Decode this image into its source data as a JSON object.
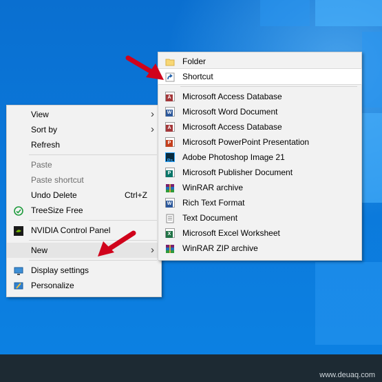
{
  "context_menu": {
    "items": [
      {
        "label": "View"
      },
      {
        "label": "Sort by"
      },
      {
        "label": "Refresh"
      },
      {
        "label": "Paste"
      },
      {
        "label": "Paste shortcut"
      },
      {
        "label": "Undo Delete",
        "shortcut": "Ctrl+Z"
      },
      {
        "label": "TreeSize Free"
      },
      {
        "label": "NVIDIA Control Panel"
      },
      {
        "label": "New"
      },
      {
        "label": "Display settings"
      },
      {
        "label": "Personalize"
      }
    ]
  },
  "new_submenu": {
    "items": [
      {
        "label": "Folder",
        "icon": "folder-icon"
      },
      {
        "label": "Shortcut",
        "icon": "shortcut-icon"
      },
      {
        "label": "Microsoft Access Database",
        "icon": "access-icon",
        "badge": "A",
        "color": "#a4373a"
      },
      {
        "label": "Microsoft Word Document",
        "icon": "word-icon",
        "badge": "W",
        "color": "#2b579a"
      },
      {
        "label": "Microsoft Access Database",
        "icon": "access-icon",
        "badge": "A",
        "color": "#a4373a"
      },
      {
        "label": "Microsoft PowerPoint Presentation",
        "icon": "powerpoint-icon",
        "badge": "P",
        "color": "#c43e1c"
      },
      {
        "label": "Adobe Photoshop Image 21",
        "icon": "photoshop-icon",
        "badge": "Ps",
        "color": "#0a2b3d"
      },
      {
        "label": "Microsoft Publisher Document",
        "icon": "publisher-icon",
        "badge": "P",
        "color": "#077568"
      },
      {
        "label": "WinRAR archive",
        "icon": "winrar-icon"
      },
      {
        "label": "Rich Text Format",
        "icon": "rtf-icon",
        "badge": "W",
        "color": "#2b579a"
      },
      {
        "label": "Text Document",
        "icon": "text-document-icon"
      },
      {
        "label": "Microsoft Excel Worksheet",
        "icon": "excel-icon",
        "badge": "X",
        "color": "#217346"
      },
      {
        "label": "WinRAR ZIP archive",
        "icon": "winrar-zip-icon"
      }
    ]
  },
  "watermark": "www.deuaq.com",
  "colors": {
    "arrow": "#d0021b",
    "taskbar": "#1d2a33",
    "desktop": "#0b78da"
  }
}
